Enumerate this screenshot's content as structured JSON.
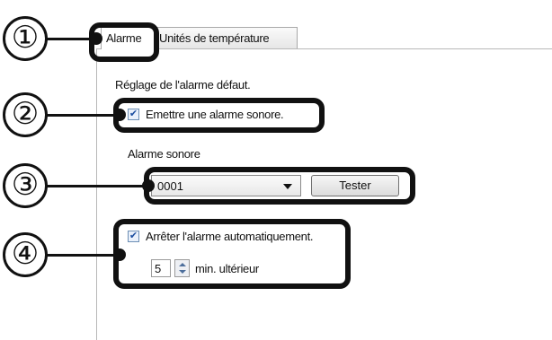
{
  "tabs": [
    {
      "label": "Alarme"
    },
    {
      "label": "Unités de température"
    }
  ],
  "markers": [
    "①",
    "②",
    "③",
    "④"
  ],
  "section": {
    "default_alarm_label": "Réglage de l'alarme défaut."
  },
  "sound_alarm": {
    "checked": true,
    "label": "Emettre une alarme sonore."
  },
  "alarm_sound": {
    "label": "Alarme sonore",
    "selected": "0001",
    "test_button": "Tester"
  },
  "auto_stop": {
    "checked": true,
    "label": "Arrêter l'alarme automatiquement.",
    "minutes": "5",
    "unit_label": "min. ultérieur"
  }
}
